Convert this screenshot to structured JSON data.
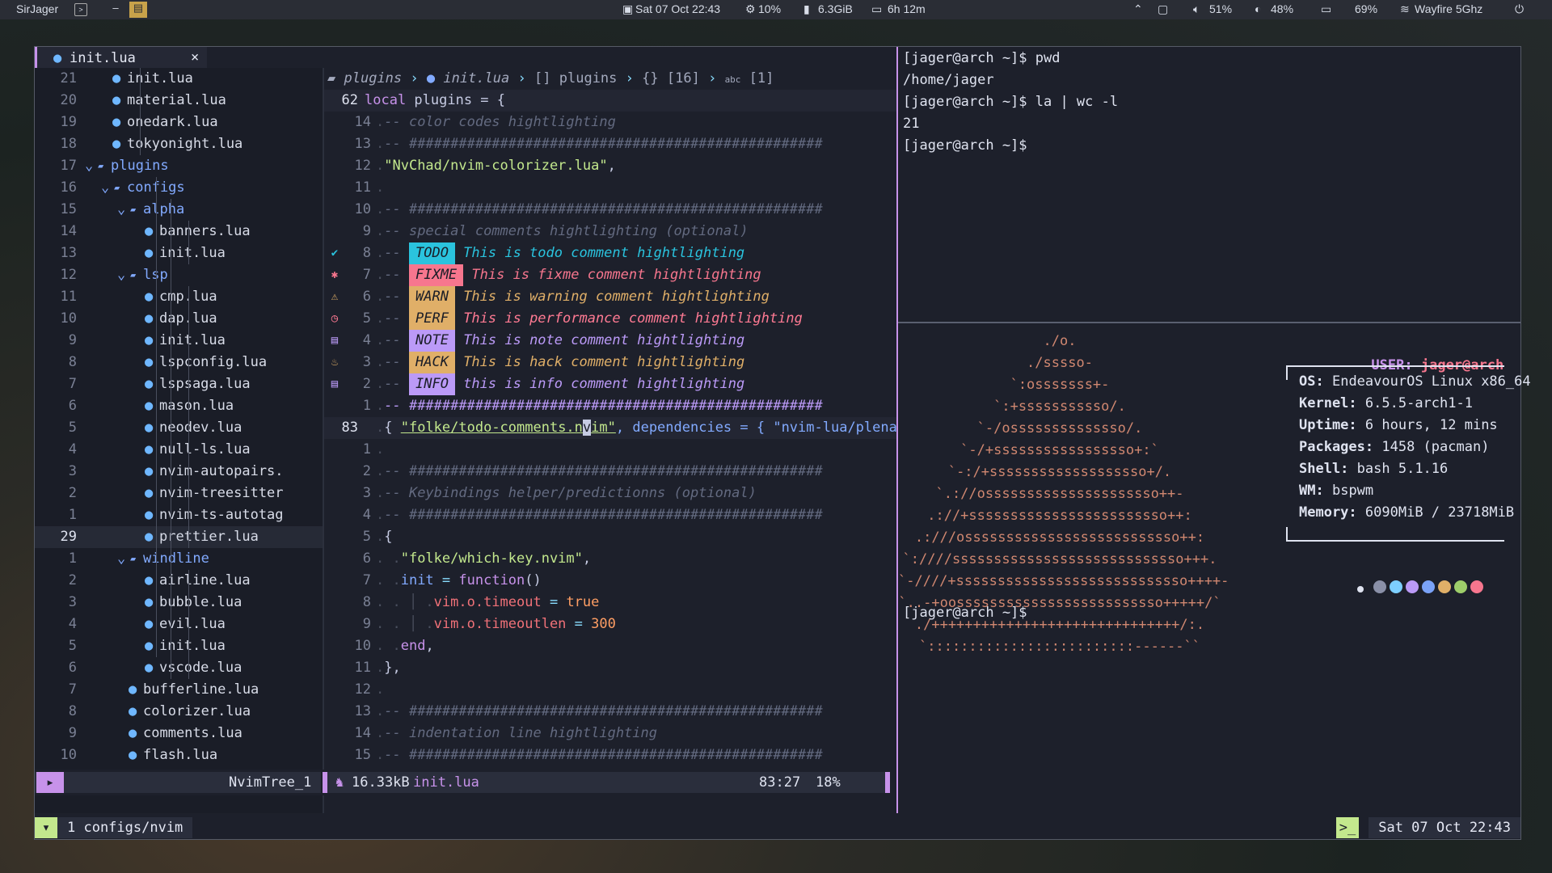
{
  "topbar": {
    "user": "SirJager",
    "clock": "Sat 07 Oct 22:43",
    "cpu": "10%",
    "mem": "6.3GiB",
    "uptime": "6h 12m",
    "volume": "51%",
    "brightness": "48%",
    "battery": "69%",
    "wifi": "Wayfire 5Ghz"
  },
  "tab": {
    "label": "init.lua",
    "close": "×"
  },
  "tree": {
    "rows": [
      {
        "ln": "21",
        "name": "init.lua",
        "indent": 2,
        "dir": false
      },
      {
        "ln": "20",
        "name": "material.lua",
        "indent": 2,
        "dir": false
      },
      {
        "ln": "19",
        "name": "onedark.lua",
        "indent": 2,
        "dir": false
      },
      {
        "ln": "18",
        "name": "tokyonight.lua",
        "indent": 2,
        "dir": false
      },
      {
        "ln": "17",
        "name": "plugins",
        "indent": 1,
        "dir": true
      },
      {
        "ln": "16",
        "name": "configs",
        "indent": 2,
        "dir": true
      },
      {
        "ln": "15",
        "name": "alpha",
        "indent": 3,
        "dir": true
      },
      {
        "ln": "14",
        "name": "banners.lua",
        "indent": 4,
        "dir": false
      },
      {
        "ln": "13",
        "name": "init.lua",
        "indent": 4,
        "dir": false
      },
      {
        "ln": "12",
        "name": "lsp",
        "indent": 3,
        "dir": true
      },
      {
        "ln": "11",
        "name": "cmp.lua",
        "indent": 4,
        "dir": false
      },
      {
        "ln": "10",
        "name": "dap.lua",
        "indent": 4,
        "dir": false
      },
      {
        "ln": "9",
        "name": "init.lua",
        "indent": 4,
        "dir": false
      },
      {
        "ln": "8",
        "name": "lspconfig.lua",
        "indent": 4,
        "dir": false
      },
      {
        "ln": "7",
        "name": "lspsaga.lua",
        "indent": 4,
        "dir": false
      },
      {
        "ln": "6",
        "name": "mason.lua",
        "indent": 4,
        "dir": false
      },
      {
        "ln": "5",
        "name": "neodev.lua",
        "indent": 4,
        "dir": false
      },
      {
        "ln": "4",
        "name": "null-ls.lua",
        "indent": 4,
        "dir": false
      },
      {
        "ln": "3",
        "name": "nvim-autopairs.",
        "indent": 4,
        "dir": false
      },
      {
        "ln": "2",
        "name": "nvim-treesitter",
        "indent": 4,
        "dir": false
      },
      {
        "ln": "1",
        "name": "nvim-ts-autotag",
        "indent": 4,
        "dir": false
      },
      {
        "ln": "29",
        "name": "prettier.lua",
        "indent": 4,
        "dir": false,
        "cur": true
      },
      {
        "ln": "1",
        "name": "windline",
        "indent": 3,
        "dir": true
      },
      {
        "ln": "2",
        "name": "airline.lua",
        "indent": 4,
        "dir": false
      },
      {
        "ln": "3",
        "name": "bubble.lua",
        "indent": 4,
        "dir": false
      },
      {
        "ln": "4",
        "name": "evil.lua",
        "indent": 4,
        "dir": false
      },
      {
        "ln": "5",
        "name": "init.lua",
        "indent": 4,
        "dir": false
      },
      {
        "ln": "6",
        "name": "vscode.lua",
        "indent": 4,
        "dir": false
      },
      {
        "ln": "7",
        "name": "bufferline.lua",
        "indent": 3,
        "dir": false
      },
      {
        "ln": "8",
        "name": "colorizer.lua",
        "indent": 3,
        "dir": false
      },
      {
        "ln": "9",
        "name": "comments.lua",
        "indent": 3,
        "dir": false
      },
      {
        "ln": "10",
        "name": "flash.lua",
        "indent": 3,
        "dir": false
      }
    ]
  },
  "winbar": {
    "seg1": "plugins",
    "seg2": "init.lua",
    "seg3": "plugins",
    "seg4": "[16]",
    "seg5": "[1]"
  },
  "editor": {
    "line62_num": "62",
    "line62_kw": "local",
    "line62_rest": " plugins = {",
    "cm_color_codes": "-- color codes hightlighting",
    "hashes": "-- ##################################################",
    "colorizer_str": "\"NvChad/nvim-colorizer.lua\"",
    "cm_special": "-- special comments hightlighting (optional)",
    "todo_tag": "TODO",
    "todo_text": "  This is todo comment hightlighting",
    "fixme_tag": "FIXME",
    "fixme_text": "This is fixme comment hightlighting",
    "warn_tag": "WARN",
    "warn_text": "This is warning comment hightlighting",
    "perf_tag": "PERF",
    "perf_text": "This is performance comment hightlighting",
    "note_tag": "NOTE",
    "note_text": "This is note comment hightlighting",
    "hack_tag": "HACK",
    "hack_text": "This is hack comment hightlighting",
    "info_tag": "INFO",
    "info_text": "this is info comment hightlighting",
    "hash_bright": "-- ##################################################",
    "line83_num": "83",
    "line83_pre": "\"folke/todo-comments.n",
    "line83_cursor": "v",
    "line83_post": "im\"",
    "line83_rest": ", dependencies = { \"nvim-lua/plena",
    "cm_keybind": "-- Keybindings helper/predictionns (optional)",
    "whichkey": "\"folke/which-key.nvim\"",
    "init_kw": "init",
    "function_kw": "function",
    "vim_timeout": "vim.o.timeout",
    "true_kw": "true",
    "vim_timeoutlen": "vim.o.timeoutlen",
    "timeoutlen_val": "300",
    "end_kw": "end",
    "cm_indent": "-- indentation line hightlighting"
  },
  "status": {
    "tree_name": "NvimTree_1",
    "size": "16.33kB",
    "file": "init.lua",
    "pos": "83:27",
    "pct": "18%"
  },
  "terminal": {
    "lines": [
      "[jager@arch ~]$ pwd",
      "/home/jager",
      "[jager@arch ~]$ la | wc -l",
      "21",
      "[jager@arch ~]$"
    ],
    "art": [
      "./o.",
      "./sssso-",
      "`:osssssss+-",
      "`:+sssssssssso/.",
      "`-/ossssssssssssso/.",
      "`-/+sssssssssssssssso+:`",
      "`-:/+sssssssssssssssssso+/.",
      "`.://osssssssssssssssssssso++-",
      ".://+ssssssssssssssssssssssso++:",
      ".:///ossssssssssssssssssssssssso++:",
      "`:////ssssssssssssssssssssssssssso+++.",
      "`-////+ssssssssssssssssssssssssssso++++-",
      "`..-+oosssssssssssssssssssssssso+++++/`",
      "./++++++++++++++++++++++++++++++/:.",
      "`:::::::::::::::::::::::::------``"
    ],
    "user_label": "USER:",
    "user_value": "jager@arch",
    "info": [
      {
        "k": "OS:",
        "v": "EndeavourOS Linux x86_64"
      },
      {
        "k": "Kernel:",
        "v": "6.5.5-arch1-1"
      },
      {
        "k": "Uptime:",
        "v": "6 hours, 12 mins"
      },
      {
        "k": "Packages:",
        "v": "1458 (pacman)"
      },
      {
        "k": "Shell:",
        "v": "bash 5.1.16"
      },
      {
        "k": "WM:",
        "v": "bspwm"
      },
      {
        "k": "Memory:",
        "v": "6090MiB / 23718MiB"
      }
    ],
    "prompt": "[jager@arch ~]$",
    "palette": [
      "#1d202b",
      "#8a90a8",
      "#7dcfff",
      "#bb9af7",
      "#7aa2f7",
      "#e0af68",
      "#9ece6a",
      "#f7768e"
    ]
  },
  "bottombar": {
    "workspace": "1 configs/nvim",
    "clock": "Sat 07 Oct 22:43"
  },
  "colors": {
    "accent": "#c792ea",
    "green": "#c3e88d",
    "todo": "#2ac3de",
    "fixme": "#f7768e",
    "warn": "#e0af68",
    "perf": "#ff7a93",
    "note": "#bb9af7",
    "hack": "#e0af68",
    "info": "#bb9af7"
  }
}
